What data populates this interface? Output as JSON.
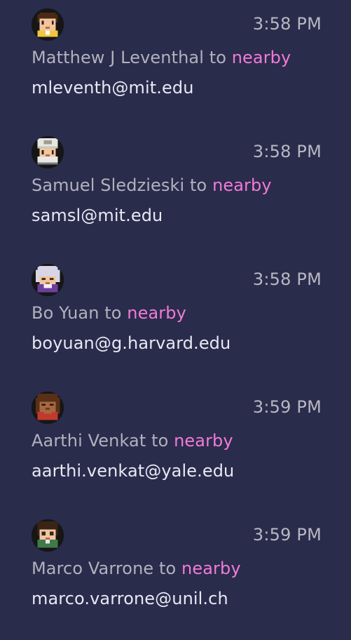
{
  "messages": [
    {
      "avatar_icon": "pixel-avatar-yellow-shirt-icon",
      "time": "3:58 PM",
      "sender": "Matthew J Leventhal",
      "connector": "to",
      "recipient": "nearby",
      "content": "mleventh@mit.edu"
    },
    {
      "avatar_icon": "pixel-avatar-white-cap-icon",
      "time": "3:58 PM",
      "sender": "Samuel Sledzieski",
      "connector": "to",
      "recipient": "nearby",
      "content": "samsl@mit.edu"
    },
    {
      "avatar_icon": "pixel-avatar-white-hair-icon",
      "time": "3:58 PM",
      "sender": "Bo Yuan",
      "connector": "to",
      "recipient": "nearby",
      "content": "boyuan@g.harvard.edu"
    },
    {
      "avatar_icon": "pixel-avatar-red-shirt-icon",
      "time": "3:59 PM",
      "sender": "Aarthi Venkat",
      "connector": "to",
      "recipient": "nearby",
      "content": "aarthi.venkat@yale.edu"
    },
    {
      "avatar_icon": "pixel-avatar-green-shirt-icon",
      "time": "3:59 PM",
      "sender": "Marco Varrone",
      "connector": "to",
      "recipient": "nearby",
      "content": "marco.varrone@unil.ch"
    }
  ],
  "colors": {
    "background": "#292c4b",
    "recipient": "#f27ad7",
    "sender": "#b3b1be",
    "content": "#e8e8f3",
    "time": "#b9b7c4"
  }
}
